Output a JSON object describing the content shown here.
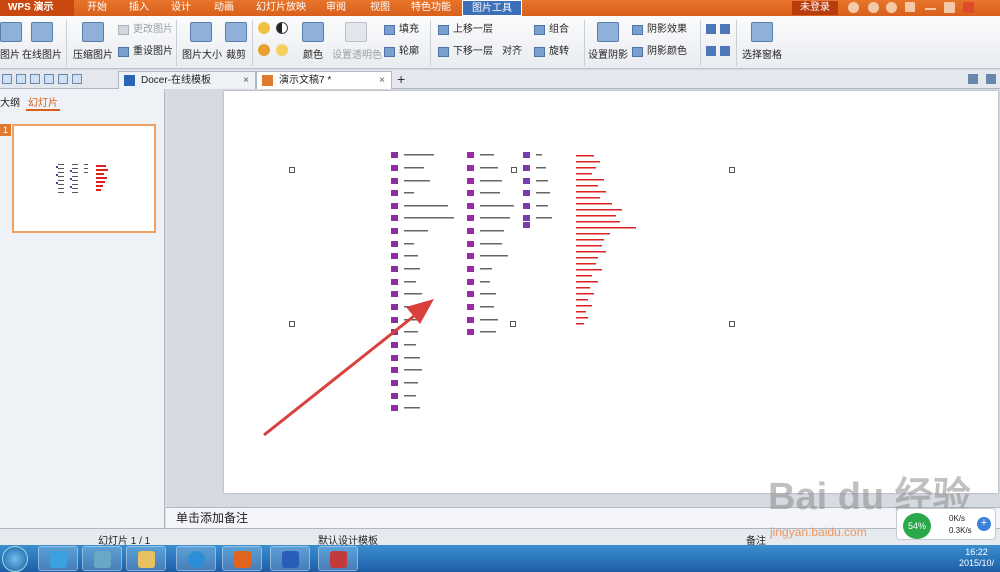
{
  "menubar": {
    "app_name": "WPS 演示",
    "tabs": [
      "开始",
      "插入",
      "设计",
      "动画",
      "幻灯片放映",
      "审阅",
      "视图",
      "特色功能",
      "图片工具"
    ],
    "active_tab": "图片工具",
    "login_label": "未登录"
  },
  "ribbon": {
    "insert_picture": "图片",
    "online_picture": "在线图片",
    "compress_picture": "压缩图片",
    "change_picture": "更改图片",
    "reset_picture": "重设图片",
    "picture_size": "图片大小",
    "crop": "裁剪",
    "color": "颜色",
    "set_transparent": "设置透明色",
    "fill": "填充",
    "outline": "轮廓",
    "bring_forward": "上移一层",
    "send_backward": "下移一层",
    "align": "对齐",
    "group": "组合",
    "rotate": "旋转",
    "set_shadow": "设置阴影",
    "shadow_effect": "阴影效果",
    "shadow_color": "阴影颜色",
    "selection_pane": "选择窗格"
  },
  "tabs": {
    "docer": "Docer-在线模板",
    "document": "演示文稿7 *",
    "close": "×",
    "add": "+"
  },
  "leftpanel": {
    "outline_tab": "大纲",
    "slides_tab": "幻灯片",
    "slide_number": "1"
  },
  "notes": {
    "placeholder": "单击添加备注"
  },
  "statusbar": {
    "slide_counter": "幻灯片 1 / 1",
    "template": "默认设计模板",
    "notes_label": "备注"
  },
  "netmon": {
    "percent": "54%",
    "up": "0K/s",
    "down": "0.3K/s",
    "plus": "+"
  },
  "taskbar": {
    "time": "16:22",
    "date": "2015/10/"
  },
  "watermark": {
    "text": "Bai du 经验",
    "url": "jingyan.baidu.com"
  },
  "colors": {
    "accent_orange": "#d8601b",
    "tool_tab_blue": "#3d6fb8",
    "arrow_red": "#d9403c",
    "net_green": "#2aa84a"
  }
}
